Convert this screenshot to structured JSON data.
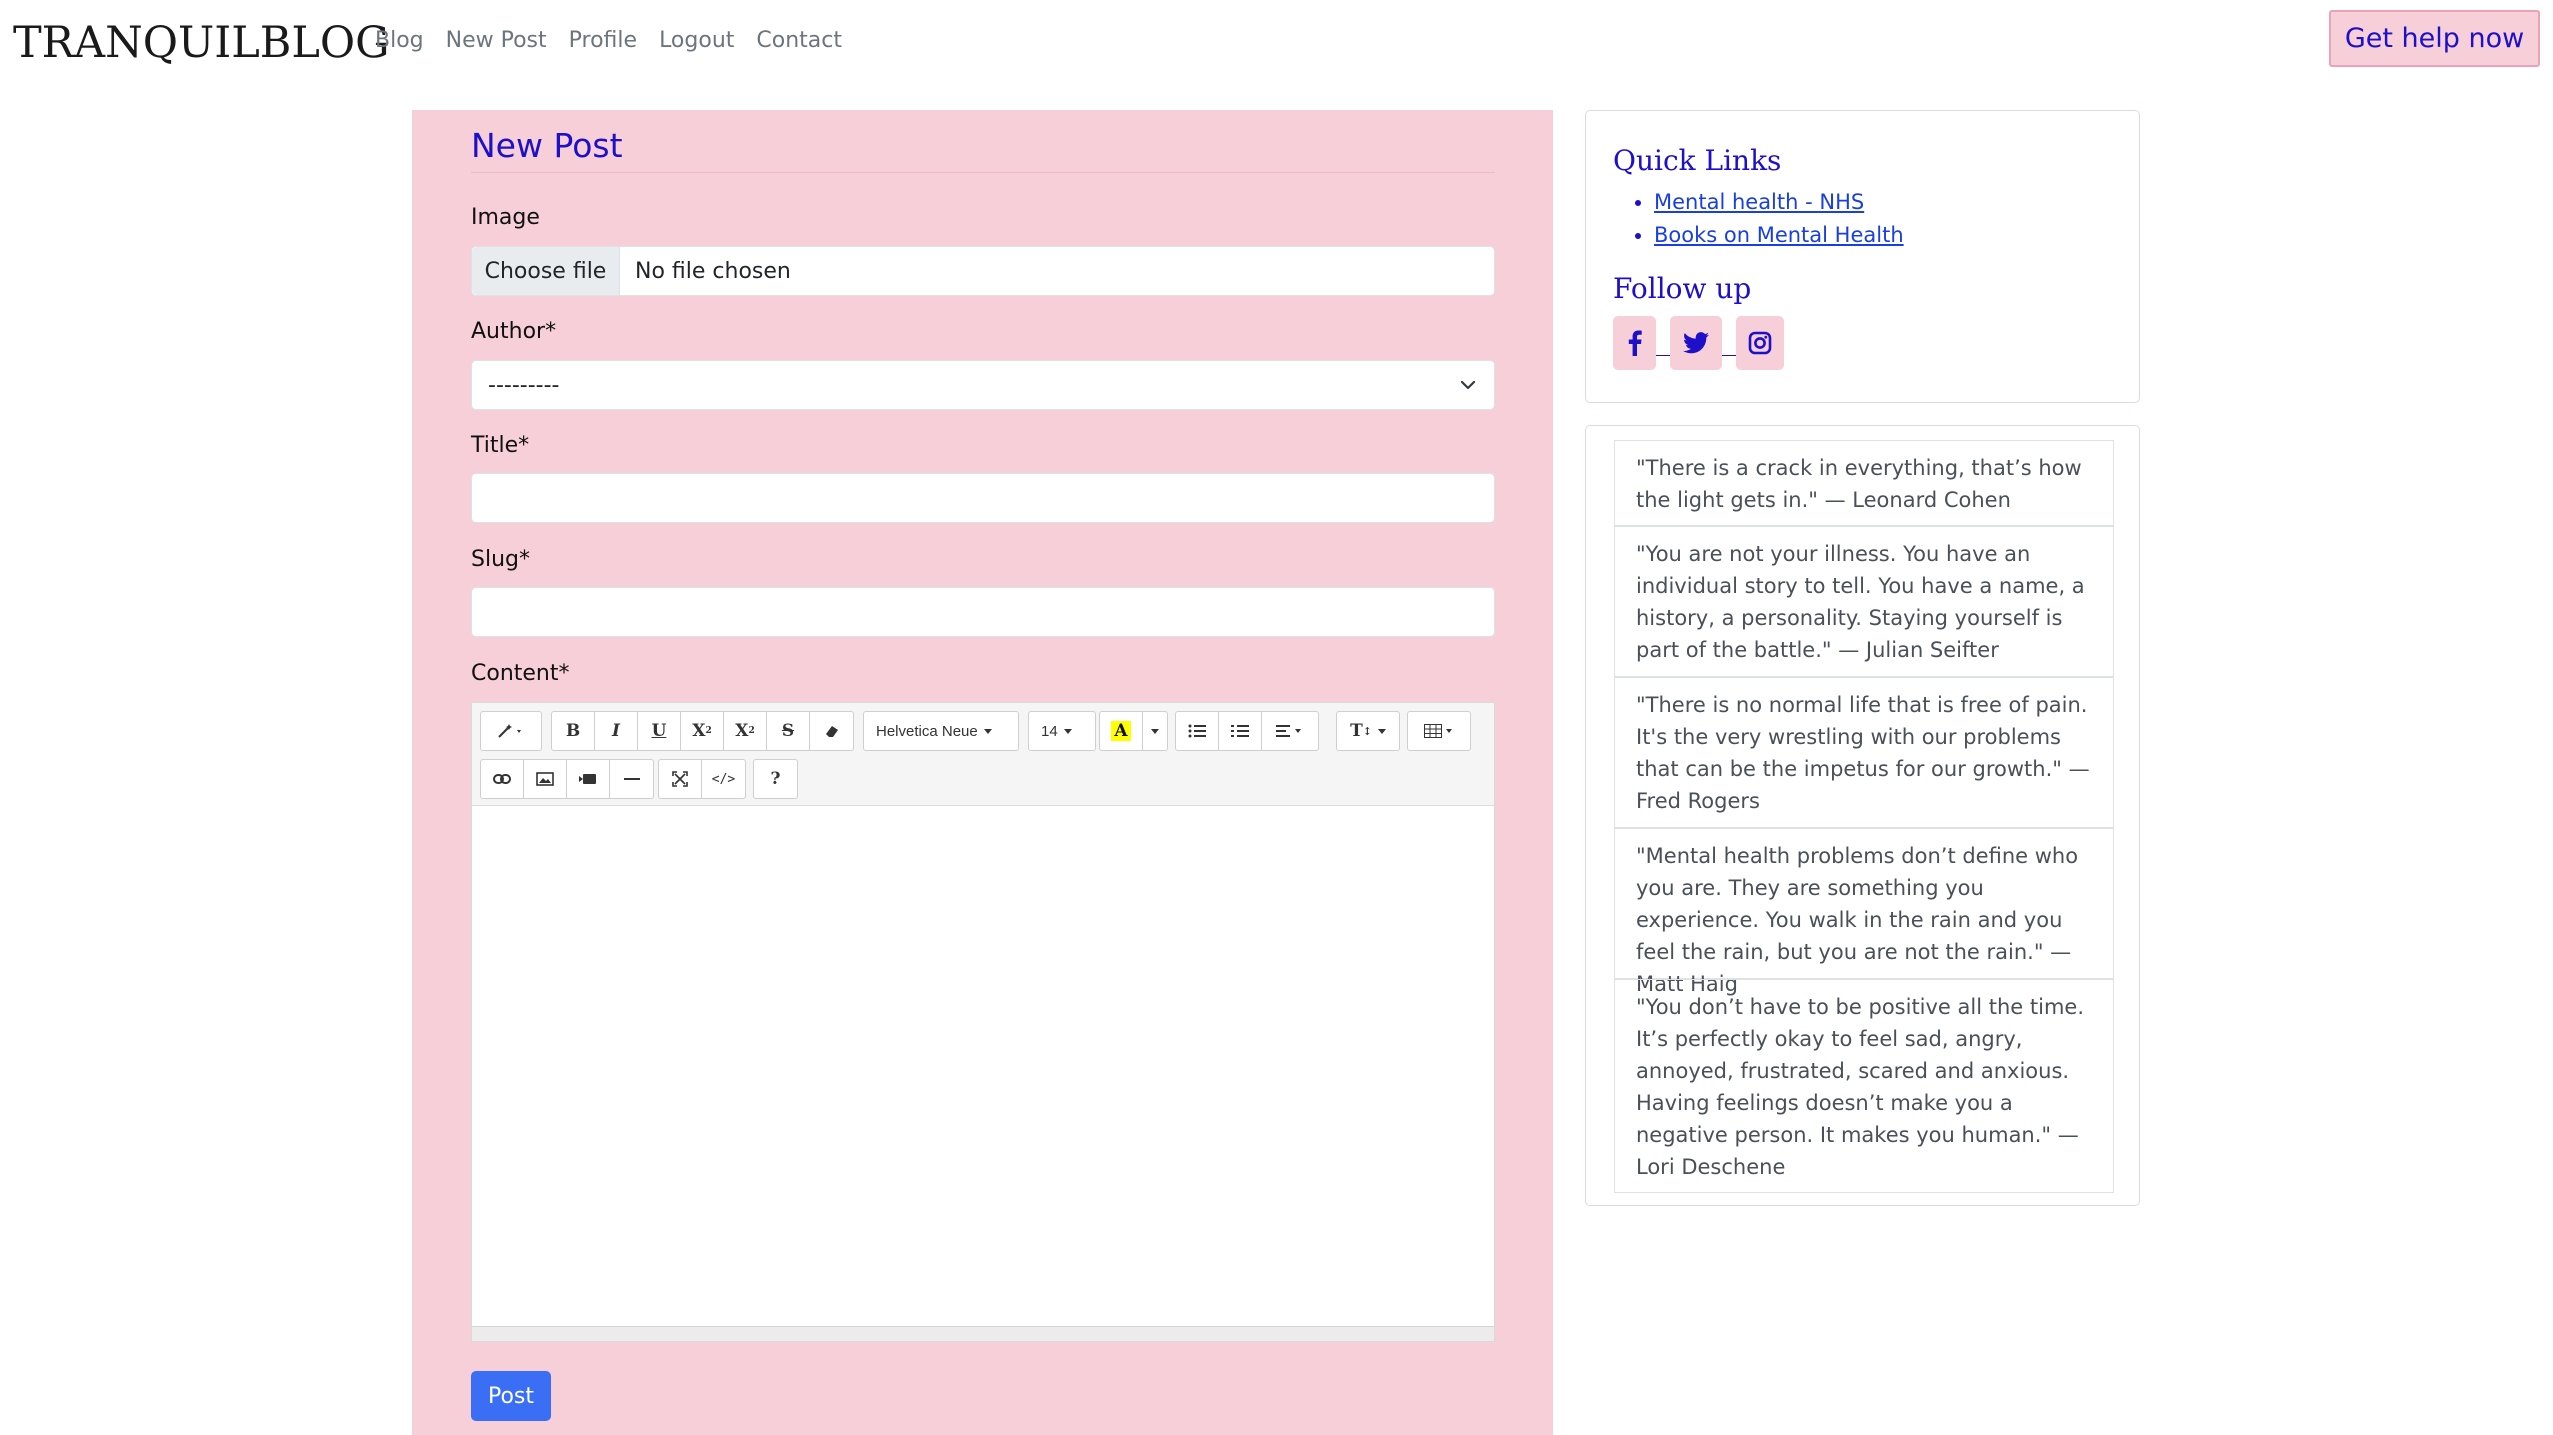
{
  "brand": "TRANQUILBLOG",
  "nav": {
    "items": [
      "Blog",
      "New Post",
      "Profile",
      "Logout",
      "Contact"
    ],
    "help_label": "Get help now"
  },
  "form": {
    "title": "New Post",
    "image_label": "Image",
    "file_button": "Choose file",
    "file_status": "No file chosen",
    "author_label": "Author*",
    "author_value": "---------",
    "title_label": "Title*",
    "title_value": "",
    "slug_label": "Slug*",
    "slug_value": "",
    "content_label": "Content*",
    "submit_label": "Post"
  },
  "editor": {
    "font_name": "Helvetica Neue",
    "font_size": "14",
    "help_glyph": "?",
    "icons_row1": [
      "magic-icon",
      "bold-icon",
      "italic-icon",
      "underline-icon",
      "superscript-icon",
      "subscript-icon",
      "strikethrough-icon",
      "eraser-icon",
      "font-color-icon",
      "unordered-list-icon",
      "ordered-list-icon",
      "align-icon",
      "line-height-icon",
      "table-icon"
    ],
    "icons_row2": [
      "link-icon",
      "picture-icon",
      "video-icon",
      "horizontal-rule-icon",
      "fullscreen-icon",
      "code-view-icon",
      "help-icon"
    ]
  },
  "sidebar": {
    "quick_links_title": "Quick Links",
    "links": [
      "Mental health - NHS",
      "Books on Mental Health"
    ],
    "follow_title": "Follow up",
    "social": [
      "facebook-icon",
      "twitter-icon",
      "instagram-icon"
    ],
    "quotes": [
      "\"There is a crack in everything, that’s how the light gets in.\" — Leonard Cohen",
      "\"You are not your illness. You have an individual story to tell. You have a name, a history, a personality. Staying yourself is part of the battle.\" — Julian Seifter",
      "\"There is no normal life that is free of pain. It's the very wrestling with our problems that can be the impetus for our growth.\" — Fred Rogers",
      "\"Mental health problems don’t define who you are. They are something you experience. You walk in the rain and you feel the rain, but you are not the rain.\" — Matt Haig",
      "\"You don’t have to be positive all the time. It’s perfectly okay to feel sad, angry, annoyed, frustrated, scared and anxious. Having feelings doesn’t make you a negative person. It makes you human.\" — Lori Deschene"
    ]
  },
  "colors": {
    "accent_pink": "#f6cfd8",
    "heading_blue": "#1e0fc9",
    "primary_button": "#3a6ff5"
  }
}
